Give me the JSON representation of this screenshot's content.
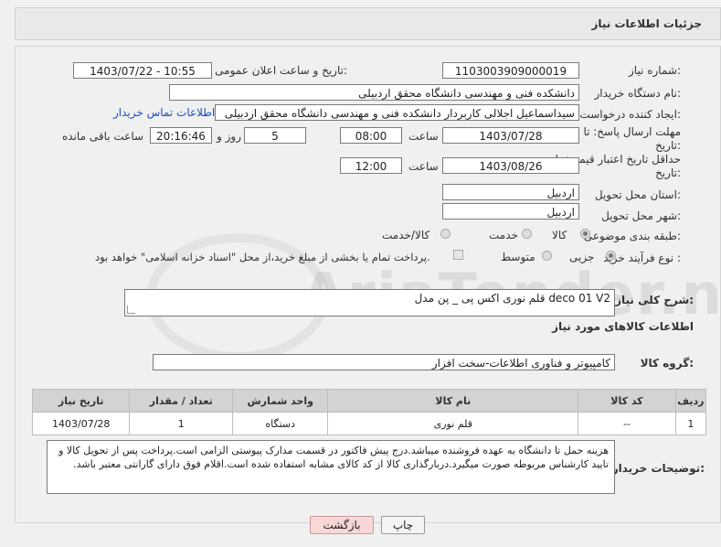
{
  "header": {
    "title": "جزئیات اطلاعات نیاز"
  },
  "fields": {
    "need_number_label": "شماره نیاز:",
    "need_number": "1103003909000019",
    "announce_label": "تاریخ و ساعت اعلان عمومی:",
    "announce_value": "1403/07/22 - 10:55",
    "buyer_label": "نام دستگاه خریدار:",
    "buyer_value": "دانشکده فنی و مهندسی دانشگاه محقق اردبیلی",
    "creator_label": "ایجاد کننده درخواست:",
    "creator_value": "سیداسماعیل اجلالی کاربردار دانشکده فنی و مهندسی دانشگاه محقق اردبیلی",
    "contact_link": "اطلاعات تماس خریدار",
    "deadline_label": "مهلت ارسال پاسخ: تا تاریخ:",
    "deadline_date": "1403/07/28",
    "time_label": "ساعت",
    "deadline_time": "08:00",
    "days_value": "5",
    "days_label": "روز و",
    "remaining_time": "20:16:46",
    "remaining_label": "ساعت باقی مانده",
    "validity_label": "حداقل تاریخ اعتبار قیمت: تا تاریخ:",
    "validity_date": "1403/08/26",
    "validity_time": "12:00",
    "province_label": "استان محل تحویل:",
    "province_value": "اردبیل",
    "city_label": "شهر محل تحویل:",
    "city_value": "اردبیل",
    "category_label": "طبقه بندی موضوعی:",
    "category_options": [
      "کالا",
      "خدمت",
      "کالا/خدمت"
    ],
    "process_label": "نوع فرآیند خرید :",
    "process_options": [
      "جزیی",
      "متوسط"
    ],
    "process_note": "پرداخت تمام یا بخشی از مبلغ خرید،از محل \"اسناد خزانه اسلامی\" خواهد بود."
  },
  "description": {
    "label": "شرح کلی نیاز:",
    "value": "قلم نوری اکس پی _ پن مدل deco 01 V2"
  },
  "goods_section": {
    "title": "اطلاعات کالاهای مورد نیاز",
    "group_label": "گروه کالا:",
    "group_value": "کامپیوتر و فناوری اطلاعات-سخت افزار"
  },
  "table": {
    "headers": [
      "ردیف",
      "کد کالا",
      "نام کالا",
      "واحد شمارش",
      "تعداد / مقدار",
      "تاریخ نیاز"
    ],
    "rows": [
      [
        "1",
        "--",
        "قلم نوری",
        "دستگاه",
        "1",
        "1403/07/28"
      ]
    ]
  },
  "buyer_notes": {
    "label": "توضیحات خریدار:",
    "value": "هزینه حمل تا دانشگاه به عهده فروشنده میباشد.درج پیش فاکتور در قسمت مدارک پیوستی الزامی است.پرداخت پس از تحویل کالا و تایید کارشناس مربوطه صورت میگیرد.دربارگذاری کالا از کد کالای مشابه استفاده شده است.اقلام فوق دارای گارانتی معتبر باشد."
  },
  "buttons": {
    "print": "چاپ",
    "back": "بازگشت"
  },
  "watermark": "AriaTender.neT",
  "colors": {
    "link": "#1a4fc9",
    "back_button": "#f8d7d7",
    "header_bg": "#e9e9e9"
  }
}
